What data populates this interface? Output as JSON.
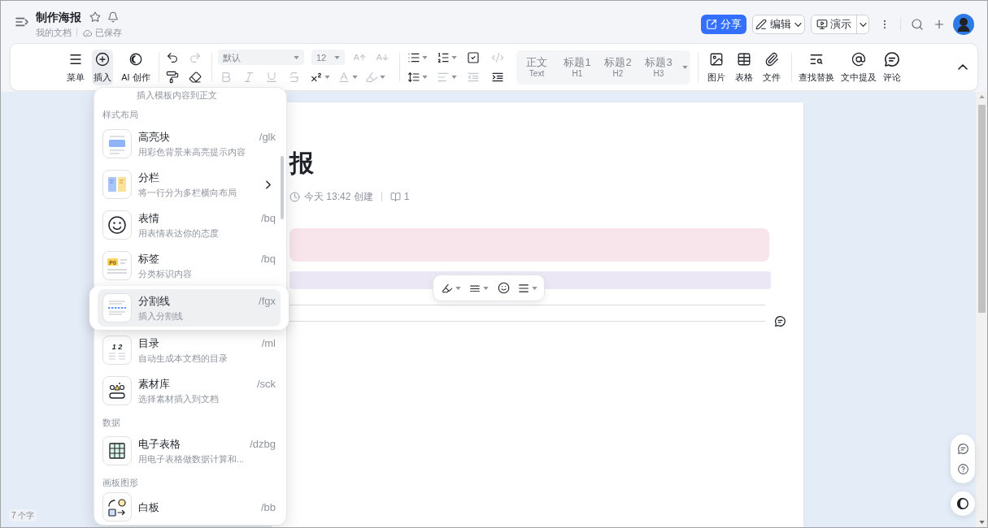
{
  "header": {
    "title": "制作海报",
    "folder": "我的文档",
    "save_status": "已保存"
  },
  "actions": [
    {
      "kind": "share",
      "label": "分享"
    },
    {
      "kind": "edit",
      "label": "编辑"
    },
    {
      "kind": "present",
      "label": "演示"
    }
  ],
  "toolbar": {
    "main": [
      {
        "kind": "menu",
        "label": "菜单",
        "selected": false
      },
      {
        "kind": "insert",
        "label": "插入",
        "selected": true
      },
      {
        "kind": "ai",
        "label": "AI 创作",
        "selected": false
      }
    ],
    "history": [
      {
        "kind": "undo",
        "disabled": false
      },
      {
        "kind": "redo",
        "disabled": true
      },
      {
        "kind": "format-painter",
        "disabled": false
      },
      {
        "kind": "eraser",
        "disabled": false
      }
    ],
    "font": {
      "value": "默认",
      "disabled": true
    },
    "size": {
      "value": "12",
      "disabled": true
    },
    "size_tools": [
      {
        "kind": "grow",
        "disabled": true
      },
      {
        "kind": "shrink",
        "disabled": true
      }
    ],
    "format_tools": [
      {
        "kind": "bold",
        "disabled": true
      },
      {
        "kind": "italic",
        "disabled": true
      },
      {
        "kind": "underline",
        "disabled": true
      },
      {
        "kind": "strikethrough",
        "disabled": true
      },
      {
        "kind": "superscript",
        "disabled": false
      },
      {
        "kind": "text-color",
        "disabled": true
      },
      {
        "kind": "highlighter",
        "disabled": true
      }
    ],
    "lists": [
      {
        "kind": "bullet-list",
        "disabled": false
      },
      {
        "kind": "numbered-list",
        "disabled": false
      },
      {
        "kind": "checklist",
        "disabled": false
      },
      {
        "kind": "code",
        "disabled": true
      }
    ],
    "layout": [
      {
        "kind": "line-spacing",
        "disabled": false
      },
      {
        "kind": "align",
        "disabled": true
      },
      {
        "kind": "outdent",
        "disabled": true
      },
      {
        "kind": "indent",
        "disabled": false
      }
    ],
    "styles": {
      "disabled": true,
      "items": [
        {
          "label": "正文",
          "sub": "Text"
        },
        {
          "label": "标题1",
          "sub": "H1"
        },
        {
          "label": "标题2",
          "sub": "H2"
        },
        {
          "label": "标题3",
          "sub": "H3"
        }
      ]
    },
    "insert": [
      {
        "kind": "image",
        "label": "图片"
      },
      {
        "kind": "table",
        "label": "表格"
      },
      {
        "kind": "file",
        "label": "文件"
      }
    ],
    "tools": [
      {
        "kind": "find-replace",
        "label": "查找替换"
      },
      {
        "kind": "mention",
        "label": "文中提及"
      },
      {
        "kind": "comment",
        "label": "评论"
      }
    ]
  },
  "insert_menu": {
    "hint": "插入模板内容到正文",
    "entries": [
      {
        "kind": "section",
        "label": "样式布局"
      },
      {
        "kind": "highlight-block",
        "title": "高亮块",
        "shortcut": "/glk",
        "description": "用彩色背景来高亮提示内容",
        "submenu": false,
        "selected": false
      },
      {
        "kind": "columns",
        "title": "分栏",
        "description": "将一行分为多栏横向布局",
        "submenu": true,
        "selected": false
      },
      {
        "kind": "emoji",
        "title": "表情",
        "shortcut": "/bq",
        "description": "用表情表达你的态度",
        "submenu": false,
        "selected": false
      },
      {
        "kind": "tag",
        "title": "标签",
        "shortcut": "/bq",
        "description": "分类标识内容",
        "icon_text": "P0",
        "submenu": false,
        "selected": false
      },
      {
        "kind": "divider",
        "title": "分割线",
        "shortcut": "/fgx",
        "description": "插入分割线",
        "submenu": false,
        "selected": true
      },
      {
        "kind": "toc",
        "title": "目录",
        "shortcut": "/ml",
        "description": "自动生成本文档的目录",
        "icon_text": "1 2",
        "submenu": false,
        "selected": false
      },
      {
        "kind": "library",
        "title": "素材库",
        "shortcut": "/sck",
        "description": "选择素材插入到文档",
        "submenu": false,
        "selected": false
      },
      {
        "kind": "section",
        "label": "数据"
      },
      {
        "kind": "spreadsheet",
        "title": "电子表格",
        "shortcut": "/dzbg",
        "description": "用电子表格做数据计算和...",
        "submenu": false,
        "selected": false
      },
      {
        "kind": "section",
        "label": "画板图形"
      },
      {
        "kind": "whiteboard",
        "title": "白板",
        "shortcut": "/bb",
        "submenu": false,
        "selected": false
      }
    ]
  },
  "document": {
    "title": "报",
    "created": "今天 13:42 创建",
    "reads": "1",
    "blocks": [
      {
        "kind": "callout",
        "color": "#f8e5eb"
      },
      {
        "kind": "band",
        "color": "#ece7f4"
      },
      {
        "kind": "divider",
        "comment": false
      },
      {
        "kind": "divider",
        "comment": true
      }
    ]
  },
  "word_count": "7 个字"
}
